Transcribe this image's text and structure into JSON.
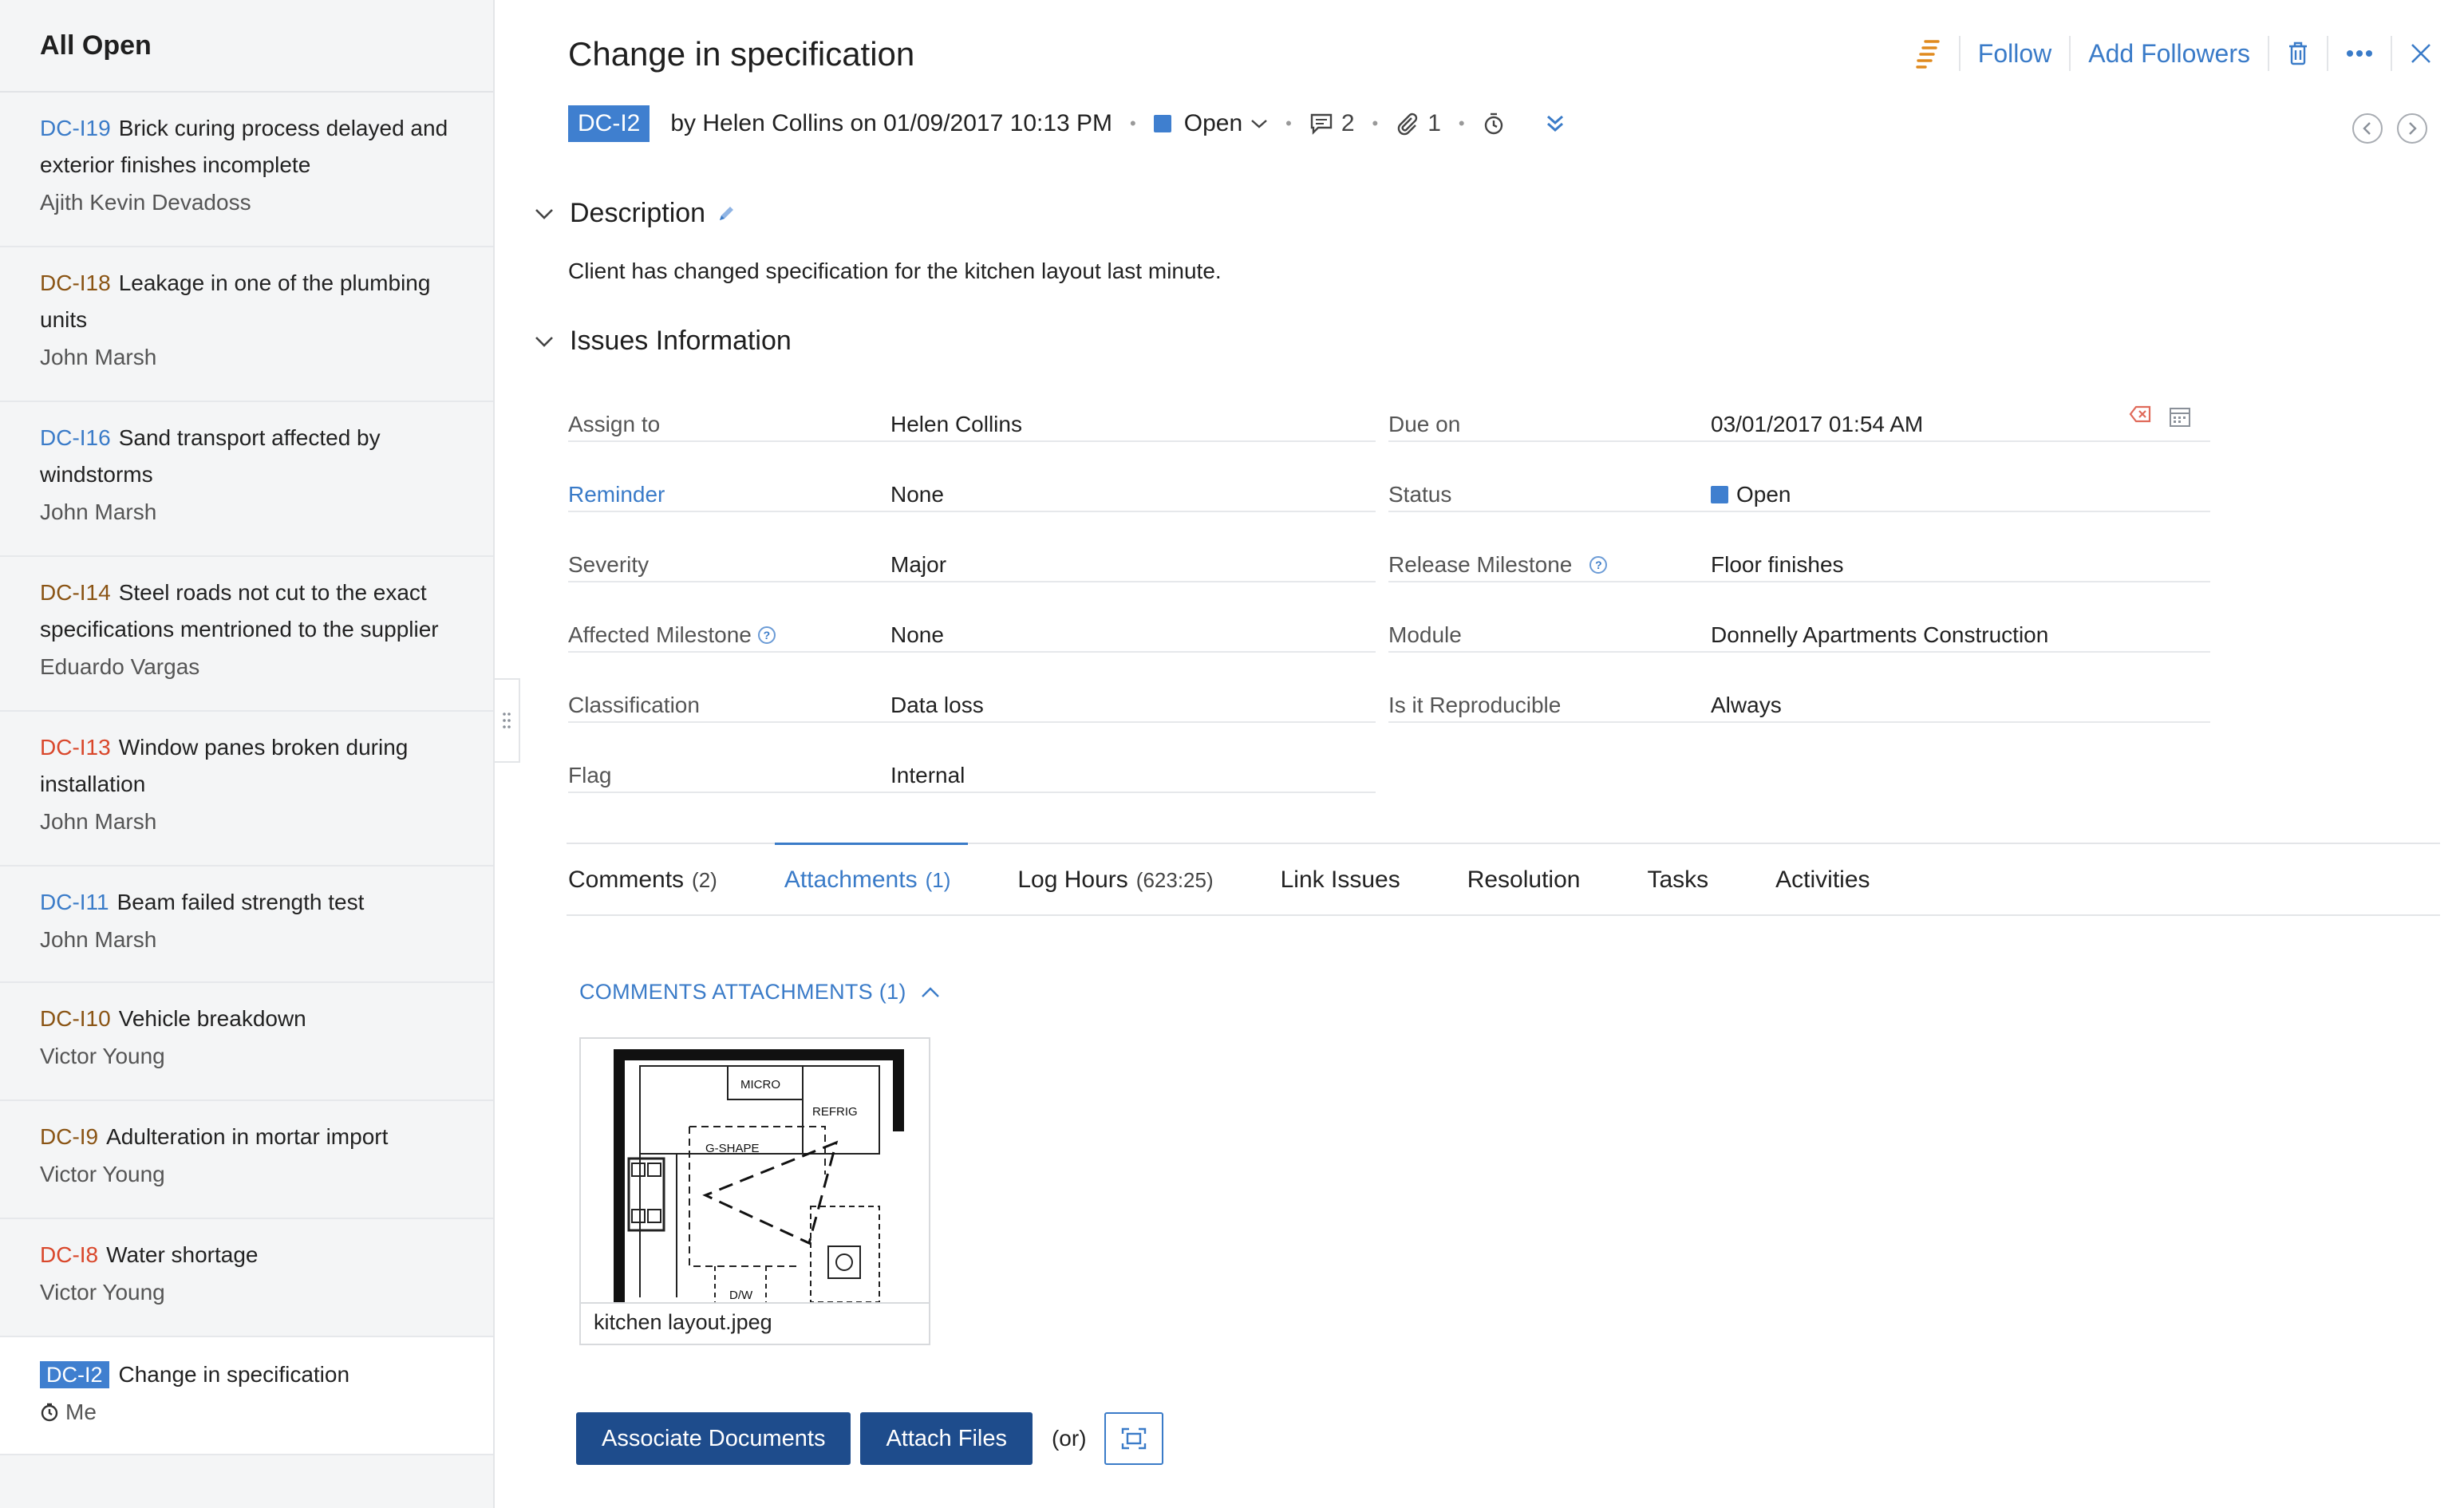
{
  "sidebar": {
    "title": "All Open",
    "items": [
      {
        "id": "DC-I19",
        "title": "Brick curing process delayed and exterior finishes incomplete",
        "assignee": "Ajith Kevin Devadoss",
        "id_color": "#3a7bc8"
      },
      {
        "id": "DC-I18",
        "title": "Leakage in one of the plumbing units",
        "assignee": "John Marsh",
        "id_color": "#8a5414"
      },
      {
        "id": "DC-I16",
        "title": "Sand transport affected by windstorms",
        "assignee": "John Marsh",
        "id_color": "#3a7bc8"
      },
      {
        "id": "DC-I14",
        "title": "Steel roads not cut to the exact specifications mentrioned to the supplier",
        "assignee": "Eduardo Vargas",
        "id_color": "#8a5414"
      },
      {
        "id": "DC-I13",
        "title": "Window panes broken during installation",
        "assignee": "John Marsh",
        "id_color": "#d9472b"
      },
      {
        "id": "DC-I11",
        "title": "Beam failed strength test",
        "assignee": "John Marsh",
        "id_color": "#3a7bc8"
      },
      {
        "id": "DC-I10",
        "title": "Vehicle breakdown",
        "assignee": "Victor Young",
        "id_color": "#8a5414"
      },
      {
        "id": "DC-I9",
        "title": "Adulteration in mortar import",
        "assignee": "Victor Young",
        "id_color": "#8a5414"
      },
      {
        "id": "DC-I8",
        "title": "Water shortage",
        "assignee": "Victor Young",
        "id_color": "#d9472b"
      }
    ],
    "selected": {
      "id": "DC-I2",
      "title": "Change in specification",
      "assignee": "Me"
    }
  },
  "issue": {
    "title": "Change in specification",
    "id": "DC-I2",
    "byline": "by Helen Collins on 01/09/2017 10:13 PM",
    "status": "Open",
    "comment_count": "2",
    "attachment_count": "1"
  },
  "header": {
    "follow_label": "Follow",
    "add_followers_label": "Add Followers"
  },
  "description": {
    "heading": "Description",
    "text": "Client has changed specification for the kitchen layout last minute."
  },
  "info": {
    "heading": "Issues Information",
    "left": [
      {
        "label": "Assign to",
        "value": "Helen Collins"
      },
      {
        "label": "Reminder",
        "value": "None"
      },
      {
        "label": "Severity",
        "value": "Major"
      },
      {
        "label": "Affected Milestone",
        "value": "None"
      },
      {
        "label": "Classification",
        "value": "Data loss"
      },
      {
        "label": "Flag",
        "value": "Internal"
      }
    ],
    "right": [
      {
        "label": "Due on",
        "value": "03/01/2017 01:54 AM"
      },
      {
        "label": "Status",
        "value": "Open"
      },
      {
        "label": "Release Milestone",
        "value": "Floor finishes"
      },
      {
        "label": "Module",
        "value": "Donnelly Apartments Construction"
      },
      {
        "label": "Is it Reproducible",
        "value": "Always"
      }
    ]
  },
  "tabs": [
    {
      "label": "Comments",
      "count": "(2)"
    },
    {
      "label": "Attachments",
      "count": "(1)"
    },
    {
      "label": "Log Hours",
      "count": "(623:25)"
    },
    {
      "label": "Link Issues",
      "count": ""
    },
    {
      "label": "Resolution",
      "count": ""
    },
    {
      "label": "Tasks",
      "count": ""
    },
    {
      "label": "Activities",
      "count": ""
    }
  ],
  "attachments": {
    "section_title": "COMMENTS ATTACHMENTS (1)",
    "file_name": "kitchen layout.jpeg",
    "drawing_labels": {
      "micro": "MICRO",
      "refrig": "REFRIG",
      "gshape": "G-SHAPE",
      "dw": "D/W"
    }
  },
  "actions": {
    "associate_label": "Associate Documents",
    "attach_label": "Attach Files",
    "or_label": "(or)"
  },
  "colors": {
    "accent": "#3a7bc8",
    "status_open": "#3f7fcf",
    "button_primary": "#1e4c8c",
    "priority_orange": "#e08a1e"
  }
}
